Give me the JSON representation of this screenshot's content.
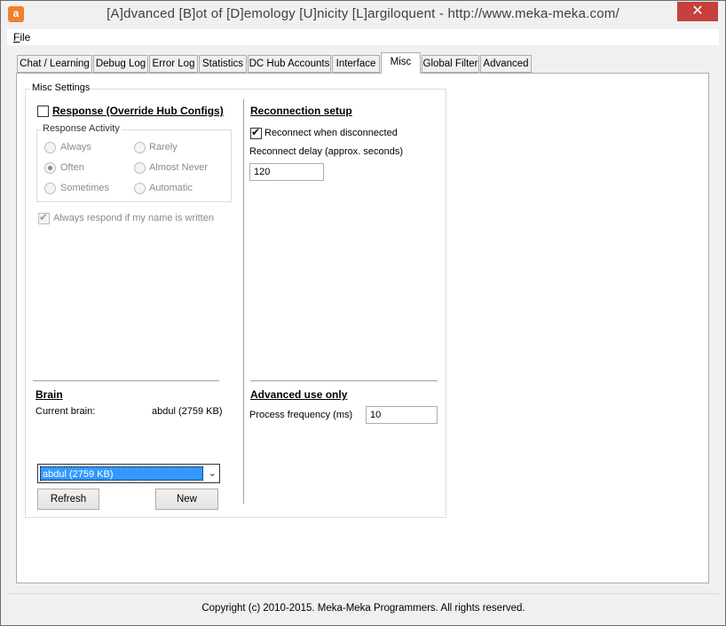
{
  "window": {
    "app_icon": "a",
    "title": "[A]dvanced [B]ot of [D]emology [U]nicity [L]argiloquent - http://www.meka-meka.com/",
    "close_glyph": "✕"
  },
  "menu": {
    "file_rest": "ile",
    "file_first": "F"
  },
  "tabs": [
    {
      "label": "Chat / Learning",
      "active": false
    },
    {
      "label": "Debug Log",
      "active": false
    },
    {
      "label": "Error Log",
      "active": false
    },
    {
      "label": "Statistics",
      "active": false
    },
    {
      "label": "DC Hub Accounts",
      "active": false
    },
    {
      "label": "Interface",
      "active": false
    },
    {
      "label": "Misc",
      "active": true
    },
    {
      "label": "Global Filter",
      "active": false
    },
    {
      "label": "Advanced",
      "active": false
    }
  ],
  "misc": {
    "group_title": "Misc Settings",
    "response": {
      "label": "Response (Override Hub Configs)",
      "checked": false,
      "activity_title": "Response Activity",
      "options": [
        "Always",
        "Rarely",
        "Often",
        "Almost Never",
        "Sometimes",
        "Automatic"
      ],
      "selected": "Often",
      "always_respond_label": "Always respond if my name is written",
      "always_respond_checked": true
    },
    "brain": {
      "heading": "Brain",
      "current_label": "Current brain:",
      "current_value": "abdul (2759 KB)",
      "combo_value": "abdul (2759 KB)",
      "refresh_label": "Refresh",
      "new_label": "New"
    },
    "reconnection": {
      "heading": "Reconnection setup",
      "reconnect_label": "Reconnect when disconnected",
      "reconnect_checked": true,
      "delay_label": "Reconnect delay (approx. seconds)",
      "delay_value": "120"
    },
    "advanced": {
      "heading": "Advanced use only",
      "freq_label": "Process frequency (ms)",
      "freq_value": "10"
    }
  },
  "status": {
    "copyright": "Copyright (c) 2010-2015. Meka-Meka Programmers. All rights reserved."
  }
}
